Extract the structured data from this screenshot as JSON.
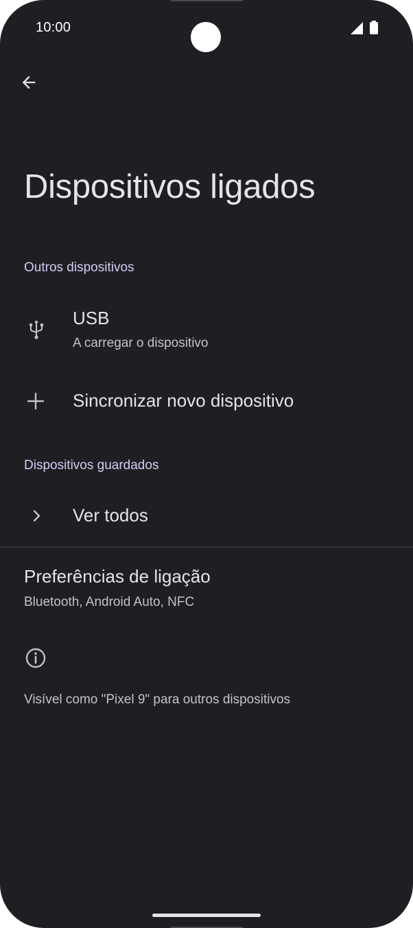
{
  "status_bar": {
    "time": "10:00",
    "icons": [
      "cellular-signal-icon",
      "battery-icon"
    ]
  },
  "header": {
    "back_icon": "arrow-back-icon",
    "title": "Dispositivos ligados"
  },
  "sections": {
    "other_devices": {
      "label": "Outros dispositivos",
      "usb": {
        "icon": "usb-icon",
        "title": "USB",
        "subtitle": "A carregar o dispositivo"
      },
      "pair_new": {
        "icon": "plus-icon",
        "title": "Sincronizar novo dispositivo"
      }
    },
    "saved_devices": {
      "label": "Dispositivos guardados",
      "see_all": {
        "icon": "chevron-right-icon",
        "title": "Ver todos"
      }
    }
  },
  "connection_preferences": {
    "title": "Preferências de ligação",
    "subtitle": "Bluetooth, Android Auto, NFC"
  },
  "footer": {
    "icon": "info-icon",
    "text": "Visível como \"Pixel 9\" para outros dispositivos"
  },
  "colors": {
    "background": "#1f1f23",
    "text_primary": "#e6e4ea",
    "text_secondary": "#c4c2c8",
    "accent": "#d2cdf4"
  }
}
